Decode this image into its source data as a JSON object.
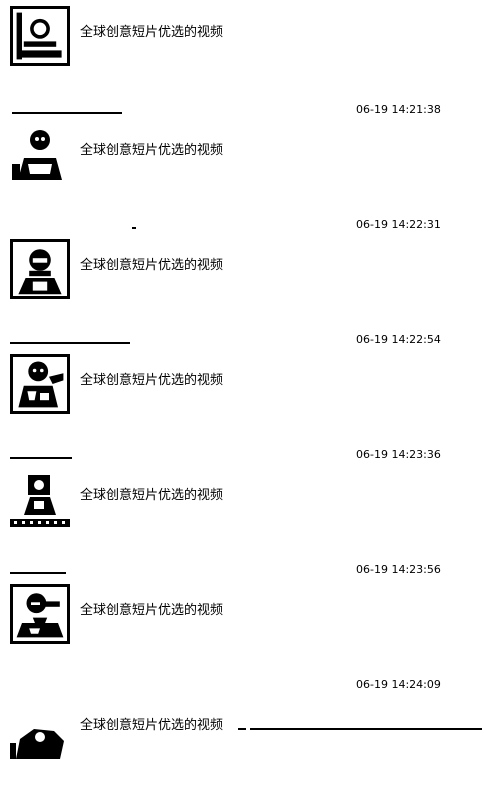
{
  "feed": {
    "items": [
      {
        "author": "",
        "time": "",
        "title": "全球创意短片优选的视频"
      },
      {
        "author": "",
        "time": "06-19 14:21:38",
        "title": "全球创意短片优选的视频"
      },
      {
        "author": "",
        "time": "06-19 14:22:31",
        "title": "全球创意短片优选的视频"
      },
      {
        "author": "",
        "time": "06-19 14:22:54",
        "title": "全球创意短片优选的视频"
      },
      {
        "author": "",
        "time": "06-19 14:23:36",
        "title": "全球创意短片优选的视频"
      },
      {
        "author": "",
        "time": "06-19 14:23:56",
        "title": "全球创意短片优选的视频"
      },
      {
        "author": "",
        "time": "06-19 14:24:09",
        "title": "全球创意短片优选的视频"
      }
    ]
  }
}
